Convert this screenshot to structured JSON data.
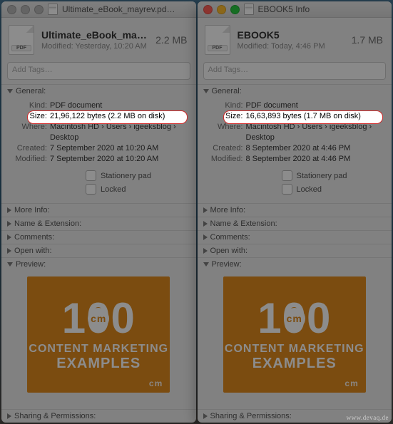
{
  "left": {
    "window_title": "Ultimate_eBook_mayrev.pd…",
    "file_name": "Ultimate_eBook_mayr…",
    "file_size_short": "2.2 MB",
    "modified_line": "Modified: Yesterday, 10:20 AM",
    "tags_placeholder": "Add Tags…",
    "general": {
      "header": "General:",
      "kind_label": "Kind:",
      "kind_value": "PDF document",
      "size_label": "Size:",
      "size_value": "21,96,122 bytes (2.2 MB on disk)",
      "where_label": "Where:",
      "where_value": "Macintosh HD › Users › igeeksblog › Desktop",
      "created_label": "Created:",
      "created_value": "7 September 2020 at 10:20 AM",
      "modified_label": "Modified:",
      "modified_value": "7 September 2020 at 10:20 AM",
      "stationery_label": "Stationery pad",
      "locked_label": "Locked"
    },
    "sections": {
      "more_info": "More Info:",
      "name_ext": "Name & Extension:",
      "comments": "Comments:",
      "open_with": "Open with:",
      "preview": "Preview:",
      "sharing": "Sharing & Permissions:"
    },
    "thumb": {
      "line1": "CONTENT MARKETING",
      "line2": "EXAMPLES",
      "mark": "cm"
    }
  },
  "right": {
    "window_title": "EBOOK5 Info",
    "file_name": "EBOOK5",
    "file_size_short": "1.7 MB",
    "modified_line": "Modified: Today, 4:46 PM",
    "tags_placeholder": "Add Tags…",
    "general": {
      "header": "General:",
      "kind_label": "Kind:",
      "kind_value": "PDF document",
      "size_label": "Size:",
      "size_value": "16,63,893 bytes (1.7 MB on disk)",
      "where_label": "Where:",
      "where_value": "Macintosh HD › Users › igeeksblog › Desktop",
      "created_label": "Created:",
      "created_value": "8 September 2020 at 4:46 PM",
      "modified_label": "Modified:",
      "modified_value": "8 September 2020 at 4:46 PM",
      "stationery_label": "Stationery pad",
      "locked_label": "Locked"
    },
    "sections": {
      "more_info": "More Info:",
      "name_ext": "Name & Extension:",
      "comments": "Comments:",
      "open_with": "Open with:",
      "preview": "Preview:",
      "sharing": "Sharing & Permissions:"
    },
    "thumb": {
      "line1": "CONTENT MARKETING",
      "line2": "EXAMPLES",
      "mark": "cm"
    }
  },
  "watermark": "www.devaq.de"
}
